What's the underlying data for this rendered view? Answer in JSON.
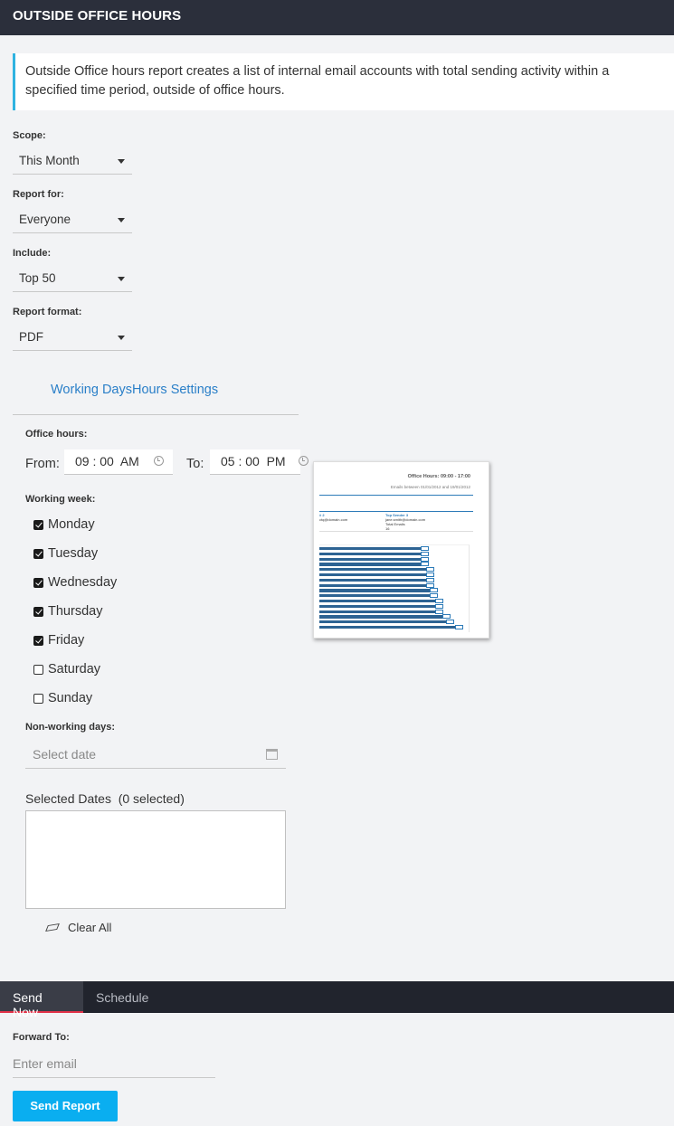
{
  "header": {
    "title": "OUTSIDE OFFICE HOURS"
  },
  "info": {
    "text": "Outside Office hours report creates a list of internal email accounts with total sending activity within a specified time period, outside of office hours."
  },
  "scope": {
    "label": "Scope:",
    "value": "This Month"
  },
  "report_for": {
    "label": "Report for:",
    "value": "Everyone"
  },
  "include": {
    "label": "Include:",
    "value": "Top 50"
  },
  "format": {
    "label": "Report format:",
    "value": "PDF"
  },
  "settings_link": "Working DaysHours Settings",
  "office_hours": {
    "label": "Office hours:",
    "from_label": "From:",
    "from_value": "09 : 00  AM",
    "to_label": "To:",
    "to_value": "05 : 00  PM"
  },
  "working_week": {
    "label": "Working week:",
    "days": [
      {
        "name": "Monday",
        "checked": true
      },
      {
        "name": "Tuesday",
        "checked": true
      },
      {
        "name": "Wednesday",
        "checked": true
      },
      {
        "name": "Thursday",
        "checked": true
      },
      {
        "name": "Friday",
        "checked": true
      },
      {
        "name": "Saturday",
        "checked": false
      },
      {
        "name": "Sunday",
        "checked": false
      }
    ]
  },
  "non_working": {
    "label": "Non-working days:",
    "placeholder": "Select date",
    "selected_title": "Selected Dates  (0 selected)",
    "clear_label": "Clear All"
  },
  "preview": {
    "title": "Office Hours: 09:00 - 17:00",
    "subtitle": "Emails between 01/01/2012 and 19/01/2012",
    "col1_head": "# 2",
    "col1_line": "ctq@domain.com",
    "col2_head": "Top Sender 3",
    "col2_line1": "jane.smith@domain.com",
    "col2_line2": "Total Emails",
    "col2_line3": "16"
  },
  "tabs": {
    "send_now": "Send Now",
    "schedule": "Schedule"
  },
  "forward": {
    "label": "Forward To:",
    "placeholder": "Enter email"
  },
  "send_button": "Send Report",
  "colors": {
    "accent": "#0aaef0",
    "header": "#2b2f3b",
    "link": "#2a7fc8",
    "tab_underline": "#e3334a"
  }
}
